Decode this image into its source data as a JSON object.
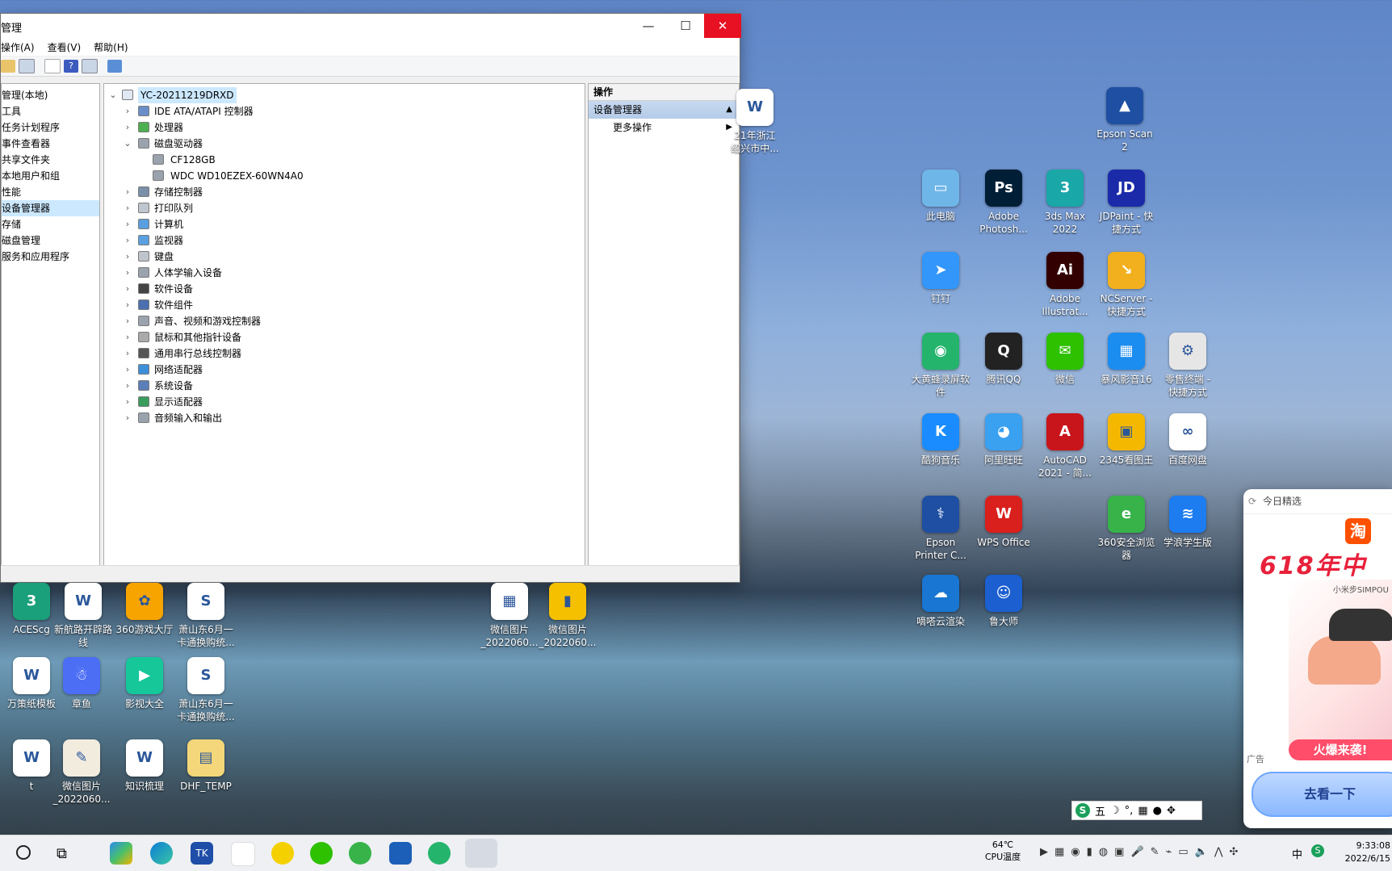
{
  "window": {
    "title": "管理",
    "menu": [
      "操作(A)",
      "查看(V)",
      "帮助(H)"
    ],
    "left_tree": [
      "管理(本地)",
      "工具",
      "任务计划程序",
      "事件查看器",
      "共享文件夹",
      "本地用户和组",
      "性能",
      "设备管理器",
      "存储",
      "磁盘管理",
      "服务和应用程序"
    ],
    "left_selected_index": 7,
    "tree": {
      "root": "YC-20211219DRXD",
      "items": [
        {
          "label": "IDE ATA/ATAPI 控制器",
          "state": "collapsed"
        },
        {
          "label": "处理器",
          "state": "collapsed"
        },
        {
          "label": "磁盘驱动器",
          "state": "expanded"
        },
        {
          "label": "CF128GB",
          "state": "child"
        },
        {
          "label": "WDC WD10EZEX-60WN4A0",
          "state": "child"
        },
        {
          "label": "存储控制器",
          "state": "collapsed"
        },
        {
          "label": "打印队列",
          "state": "collapsed"
        },
        {
          "label": "计算机",
          "state": "collapsed"
        },
        {
          "label": "监视器",
          "state": "collapsed"
        },
        {
          "label": "键盘",
          "state": "collapsed"
        },
        {
          "label": "人体学输入设备",
          "state": "collapsed"
        },
        {
          "label": "软件设备",
          "state": "collapsed"
        },
        {
          "label": "软件组件",
          "state": "collapsed"
        },
        {
          "label": "声音、视频和游戏控制器",
          "state": "collapsed"
        },
        {
          "label": "鼠标和其他指针设备",
          "state": "collapsed"
        },
        {
          "label": "通用串行总线控制器",
          "state": "collapsed"
        },
        {
          "label": "网络适配器",
          "state": "collapsed"
        },
        {
          "label": "系统设备",
          "state": "collapsed"
        },
        {
          "label": "显示适配器",
          "state": "collapsed"
        },
        {
          "label": "音频输入和输出",
          "state": "collapsed"
        }
      ]
    },
    "actions": {
      "header": "操作",
      "section": "设备管理器",
      "item": "更多操作"
    }
  },
  "desktop_icons": [
    {
      "label": "21年浙江\n绍兴市中...",
      "color": "#ffffff",
      "glyph": "W"
    },
    {
      "label": "Epson Scan\n2",
      "color": "#1e4fa3",
      "glyph": "▲"
    },
    {
      "label": "此电脑",
      "color": "#6fb6e8",
      "glyph": "▭"
    },
    {
      "label": "Adobe\nPhotosh...",
      "color": "#001e36",
      "glyph": "Ps"
    },
    {
      "label": "3ds Max\n2022",
      "color": "#1aa7a7",
      "glyph": "3"
    },
    {
      "label": "JDPaint - 快\n捷方式",
      "color": "#1a2aa8",
      "glyph": "JD"
    },
    {
      "label": "钉钉",
      "color": "#3296fa",
      "glyph": "➤"
    },
    {
      "label": "Adobe\nIllustrat...",
      "color": "#330000",
      "glyph": "Ai"
    },
    {
      "label": "NCServer -\n快捷方式",
      "color": "#f2b01e",
      "glyph": "↘"
    },
    {
      "label": "大黄蜂录屏软\n件",
      "color": "#25b46c",
      "glyph": "◉"
    },
    {
      "label": "腾讯QQ",
      "color": "#222222",
      "glyph": "Q"
    },
    {
      "label": "微信",
      "color": "#2dc100",
      "glyph": "✉"
    },
    {
      "label": "暴风影音16",
      "color": "#1b8cf0",
      "glyph": "▦"
    },
    {
      "label": "零售终端 -\n快捷方式",
      "color": "#e6e6e6",
      "glyph": "⚙"
    },
    {
      "label": "酷狗音乐",
      "color": "#1a8cff",
      "glyph": "K"
    },
    {
      "label": "阿里旺旺",
      "color": "#3aa0f0",
      "glyph": "◕"
    },
    {
      "label": "AutoCAD\n2021 - 简...",
      "color": "#c8151b",
      "glyph": "A"
    },
    {
      "label": "2345看图王",
      "color": "#f5b800",
      "glyph": "▣"
    },
    {
      "label": "百度网盘",
      "color": "#ffffff",
      "glyph": "∞"
    },
    {
      "label": "Epson\nPrinter C...",
      "color": "#1e4fa3",
      "glyph": "⚕"
    },
    {
      "label": "WPS Office",
      "color": "#d9201c",
      "glyph": "W"
    },
    {
      "label": "360安全浏览\n器",
      "color": "#37b34a",
      "glyph": "e"
    },
    {
      "label": "学浪学生版",
      "color": "#1c7cf0",
      "glyph": "≋"
    },
    {
      "label": "嘀嗒云渲染",
      "color": "#1976d2",
      "glyph": "☁"
    },
    {
      "label": "鲁大师",
      "color": "#1b5fd0",
      "glyph": "☺"
    },
    {
      "label": "ACEScg",
      "color": "#1aa07a",
      "glyph": "3"
    },
    {
      "label": "新航路开辟路\n线",
      "color": "#ffffff",
      "glyph": "W"
    },
    {
      "label": "360游戏大厅",
      "color": "#f7a400",
      "glyph": "✿"
    },
    {
      "label": "萧山东6月一\n卡通换购统...",
      "color": "#ffffff",
      "glyph": "S"
    },
    {
      "label": "微信图片\n_2022060...",
      "color": "#ffffff",
      "glyph": "▦"
    },
    {
      "label": "微信图片\n_2022060...",
      "color": "#f5c000",
      "glyph": "▮"
    },
    {
      "label": "万策纸模板",
      "color": "#ffffff",
      "glyph": "W"
    },
    {
      "label": "章鱼",
      "color": "#4c6ef5",
      "glyph": "☃"
    },
    {
      "label": "影视大全",
      "color": "#16c79a",
      "glyph": "▶"
    },
    {
      "label": "萧山东6月一\n卡通换购统...",
      "color": "#ffffff",
      "glyph": "S"
    },
    {
      "label": "t",
      "color": "#ffffff",
      "glyph": "W"
    },
    {
      "label": "微信图片\n_2022060...",
      "color": "#f2ecdf",
      "glyph": "✎"
    },
    {
      "label": "知识梳理",
      "color": "#ffffff",
      "glyph": "W"
    },
    {
      "label": "DHF_TEMP",
      "color": "#f4d77a",
      "glyph": "▤"
    }
  ],
  "ad": {
    "header": "今日精选",
    "brand": "淘",
    "headline": "618年中",
    "sub": "小米步SIMPOU",
    "tag": "广告",
    "badge": "火爆来袭!",
    "button": "去看一下"
  },
  "ime": {
    "mode": "五"
  },
  "taskbar": {
    "temp": "64℃",
    "temp_label": "CPU温度",
    "time": "9:33:08",
    "date": "2022/6/15",
    "lang": "中"
  }
}
